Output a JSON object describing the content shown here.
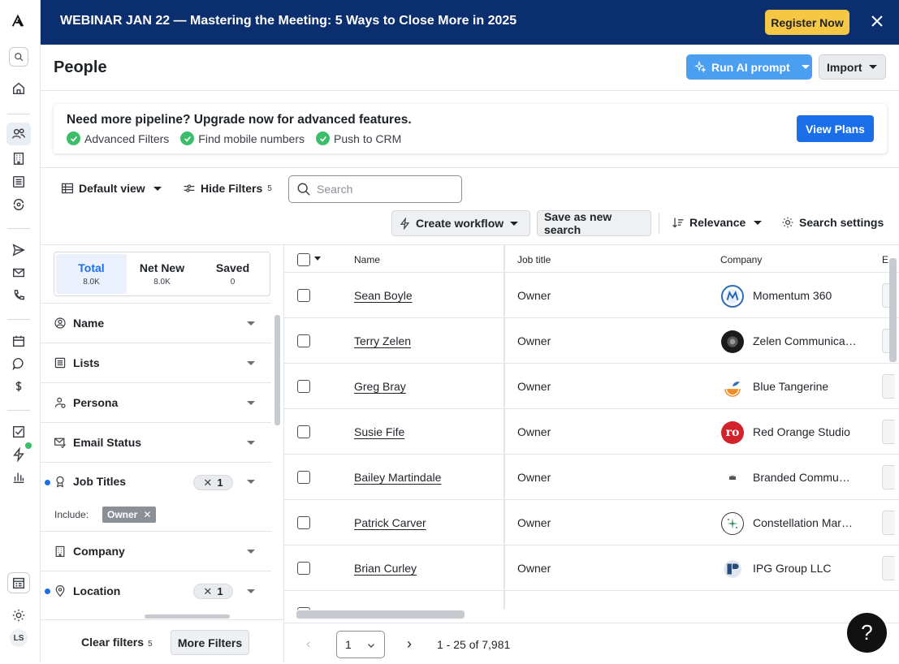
{
  "banner": {
    "text": "WEBINAR JAN 22 — Mastering the Meeting: 5 Ways to Close More in 2025",
    "register_label": "Register Now"
  },
  "header": {
    "title": "People",
    "ai_button": "Run AI prompt",
    "import_button": "Import"
  },
  "upsell": {
    "heading": "Need more pipeline? Upgrade now for advanced features.",
    "features": [
      "Advanced Filters",
      "Find mobile numbers",
      "Push to CRM"
    ],
    "cta": "View Plans"
  },
  "toolbar": {
    "view_label": "Default view",
    "hide_filters_label": "Hide Filters",
    "hide_filters_count": "5",
    "search_placeholder": "Search",
    "create_workflow": "Create workflow",
    "save_search": "Save as new search",
    "sort_label": "Relevance",
    "settings_label": "Search settings"
  },
  "filters": {
    "tabs": [
      {
        "label": "Total",
        "count": "8.0K"
      },
      {
        "label": "Net New",
        "count": "8.0K"
      },
      {
        "label": "Saved",
        "count": "0"
      }
    ],
    "items": [
      {
        "label": "Name",
        "icon": "person-circle-icon"
      },
      {
        "label": "Lists",
        "icon": "list-icon"
      },
      {
        "label": "Persona",
        "icon": "persona-icon"
      },
      {
        "label": "Email Status",
        "icon": "email-check-icon"
      },
      {
        "label": "Job Titles",
        "icon": "badge-icon",
        "count": "1"
      },
      {
        "label": "Company",
        "icon": "building-icon"
      },
      {
        "label": "Location",
        "icon": "map-pin-icon",
        "count": "1"
      }
    ],
    "include_label": "Include:",
    "job_title_chip": "Owner",
    "clear_label": "Clear filters",
    "clear_count": "5",
    "more_label": "More Filters"
  },
  "table": {
    "columns": [
      "Name",
      "Job title",
      "Company",
      "E"
    ],
    "rows": [
      {
        "name": "Sean Boyle",
        "title": "Owner",
        "company": "Momentum 360"
      },
      {
        "name": "Terry Zelen",
        "title": "Owner",
        "company": "Zelen Communica…"
      },
      {
        "name": "Greg Bray",
        "title": "Owner",
        "company": "Blue Tangerine"
      },
      {
        "name": "Susie Fife",
        "title": "Owner",
        "company": "Red Orange Studio"
      },
      {
        "name": "Bailey Martindale",
        "title": "Owner",
        "company": "Branded Commu…"
      },
      {
        "name": "Patrick Carver",
        "title": "Owner",
        "company": "Constellation Mar…"
      },
      {
        "name": "Brian Curley",
        "title": "Owner",
        "company": "IPG Group LLC"
      }
    ]
  },
  "pager": {
    "page": "1",
    "range": "1 - 25 of 7,981"
  },
  "user": {
    "initials": "LS"
  },
  "help": "?",
  "colors": {
    "banner_bg": "#0b2e6e",
    "register_bg": "#f6c744",
    "primary": "#1a6fe8",
    "ai_button": "#4a9ff0",
    "check_green": "#3bbd6a"
  }
}
